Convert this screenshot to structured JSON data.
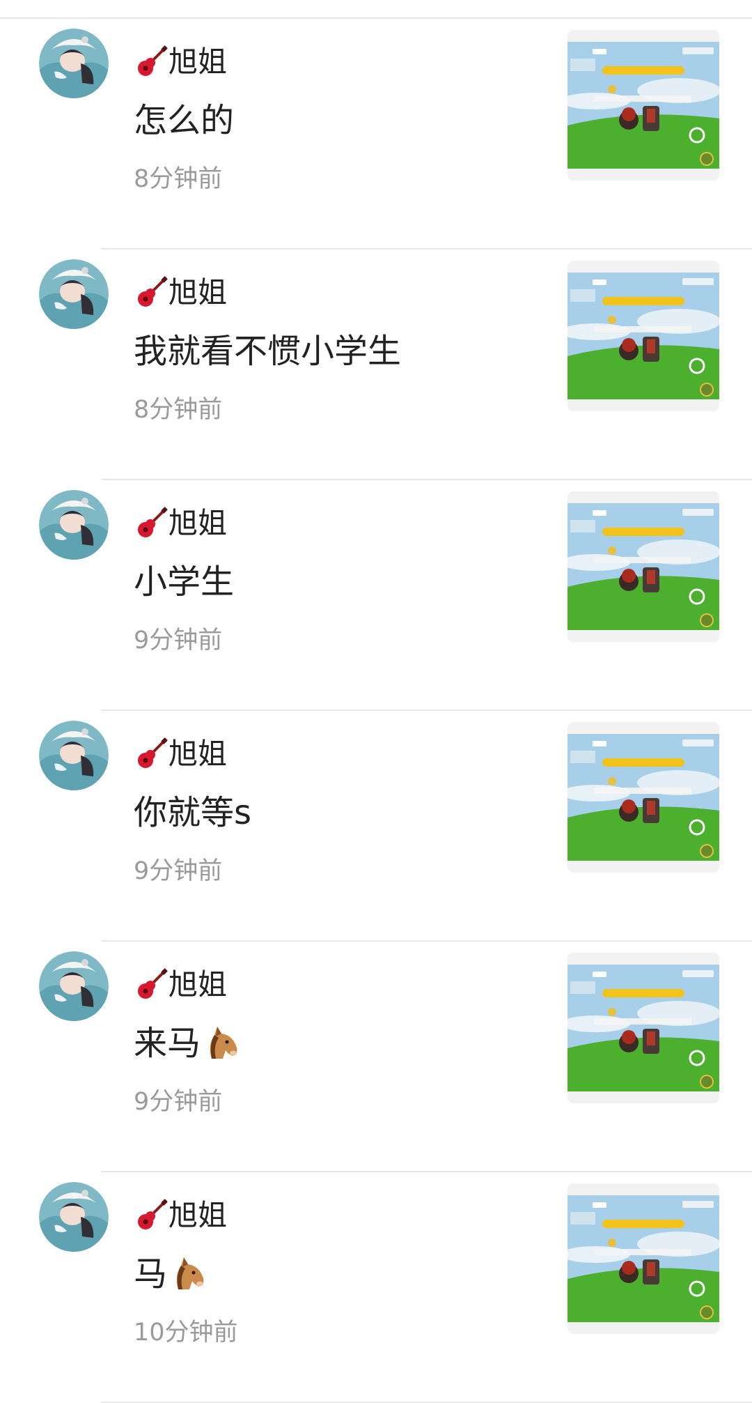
{
  "comments": [
    {
      "user": "旭姐",
      "text": "怎么的",
      "time": "8分钟前",
      "has_horse": false
    },
    {
      "user": "旭姐",
      "text": "我就看不惯小学生",
      "time": "8分钟前",
      "has_horse": false
    },
    {
      "user": "旭姐",
      "text": "小学生",
      "time": "9分钟前",
      "has_horse": false
    },
    {
      "user": "旭姐",
      "text": "你就等s",
      "time": "9分钟前",
      "has_horse": false
    },
    {
      "user": "旭姐",
      "text": "来马",
      "time": "9分钟前",
      "has_horse": true
    },
    {
      "user": "旭姐",
      "text": "马",
      "time": "10分钟前",
      "has_horse": true
    }
  ],
  "icons": {
    "name_prefix": "guitar-icon",
    "emoji": "horse-face-icon"
  },
  "colors": {
    "text_primary": "#222222",
    "text_secondary": "#9a9a9a",
    "divider": "#e8e8e8",
    "thumb_sky": "#9fc8e6",
    "thumb_grass": "#4caf2e",
    "thumb_banner": "#f2c31a"
  }
}
